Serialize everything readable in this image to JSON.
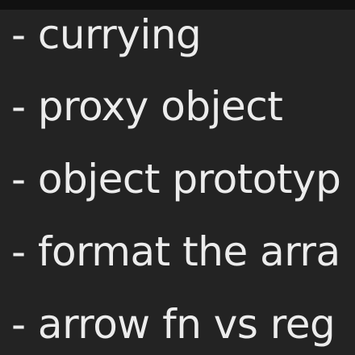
{
  "notes": {
    "lines": [
      "- currying",
      "- proxy object",
      "- object prototyp",
      "- format the arra",
      "- arrow fn vs reg"
    ]
  }
}
